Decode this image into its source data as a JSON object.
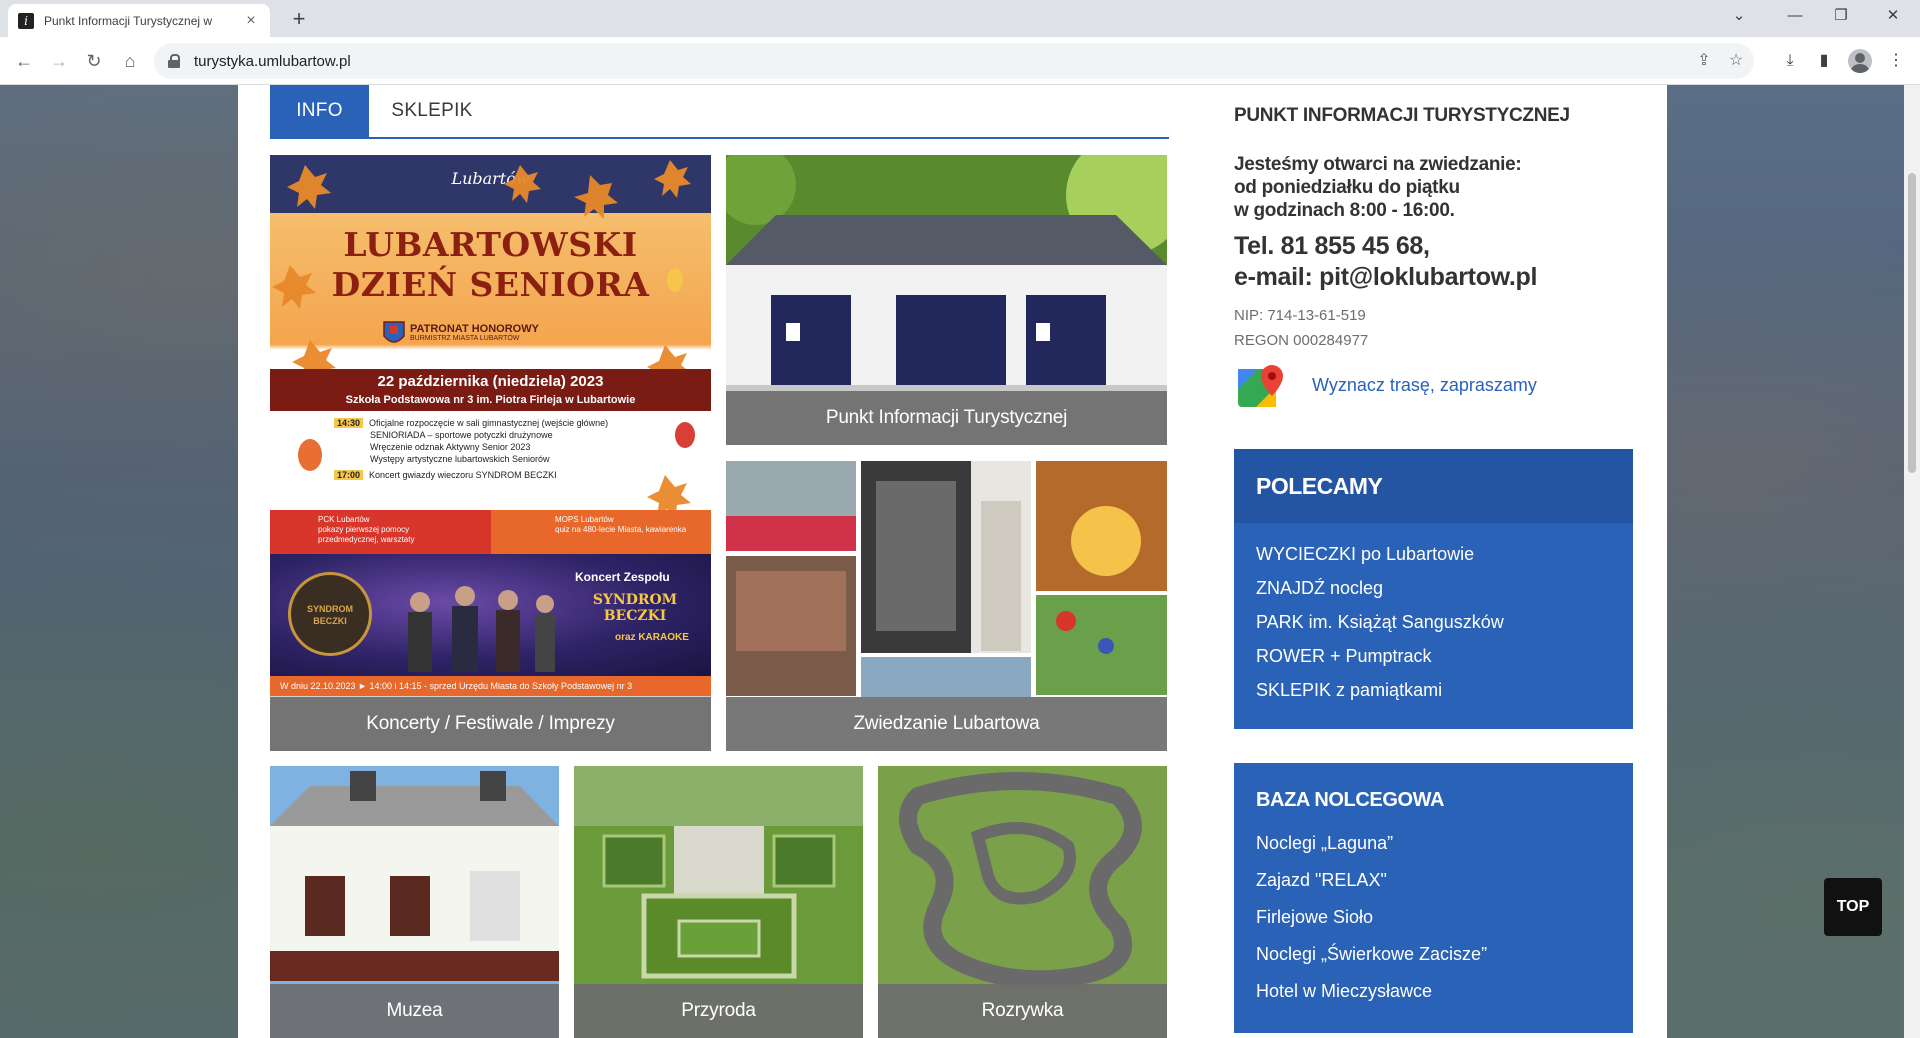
{
  "browser": {
    "tab_title": "Punkt Informacji Turystycznej w",
    "favicon_letter": "i",
    "url": "turystyka.umlubartow.pl",
    "new_tab": "+",
    "close": "×"
  },
  "page_tabs": {
    "active": "INFO",
    "inactive": "SKLEPIK"
  },
  "tiles": {
    "poster_caption": "Koncerty / Festiwale / Imprezy",
    "info_point_caption": "Punkt Informacji Turystycznej",
    "sightseeing_caption": "Zwiedzanie Lubartowa",
    "museums_caption": "Muzea",
    "nature_caption": "Przyroda",
    "fun_caption": "Rozrywka"
  },
  "poster": {
    "logo": "Lubartów",
    "title_line1": "LUBARTOWSKI",
    "title_line2": "DZIEŃ SENIORA",
    "patron": "PATRONAT HONOROWY",
    "patron_sub": "BURMISTRZ MIASTA LUBARTÓW",
    "date": "22 października (niedziela) 2023",
    "venue": "Szkoła Podstawowa nr 3 im. Piotra Firleja w Lubartowie",
    "schedule": [
      {
        "time": "14:30",
        "text": "Oficjalne rozpoczęcie w sali gimnastycznej (wejście główne)"
      },
      {
        "time": "",
        "text": "SENIORIADA – sportowe potyczki drużynowe"
      },
      {
        "time": "",
        "text": "Wręczenie odznak Aktywny Senior 2023"
      },
      {
        "time": "",
        "text": "Występy artystyczne lubartowskich Seniorów"
      },
      {
        "time": "17:00",
        "text": "Koncert gwiazdy wieczoru SYNDROM BECZKI"
      }
    ],
    "pck": "PCK Lubartów",
    "pck_text": "pokazy pierwszej pomocy przedmedycznej, warsztaty",
    "mops": "MOPS Lubartów",
    "mops_text": "quiz na 480-lecie Miasta, kawiarenka",
    "concert_title": "Koncert Zespołu",
    "band": "SYNDROM BECZKI",
    "karaoke": "oraz KARAOKE",
    "band_logo": "SYNDROM BECZKI",
    "footer": "W dniu 22.10.2023   ► 14:00 i 14:15 - sprzed Urzędu Miasta do Szkoły Podstawowej nr 3"
  },
  "sidebar": {
    "title": "PUNKT INFORMACJI TURYSTYCZNEJ",
    "hours_line1": "Jesteśmy otwarci na zwiedzanie:",
    "hours_line2": "od poniedziałku do piątku",
    "hours_line3": "w godzinach 8:00 - 16:00.",
    "phone": "Tel. 81 855 45 68,",
    "email": "e-mail: pit@loklubartow.pl",
    "nip": "NIP: 714-13-61-519",
    "regon": "REGON 000284977",
    "maps_link": "Wyznacz trasę, zapraszamy",
    "recommend_title": "POLECAMY",
    "recommend_items": [
      "WYCIECZKI po Lubartowie",
      "ZNAJDŹ nocleg",
      "PARK im. Książąt Sanguszków",
      "ROWER + Pumptrack",
      "SKLEPIK z pamiątkami"
    ],
    "lodging_title": "BAZA NOLCEGOWA",
    "lodging_items": [
      "Noclegi „Laguna”",
      "Zajazd \"RELAX\"",
      "Firlejowe Sioło",
      "Noclegi „Świerkowe Zacisze”",
      "Hotel w Mieczysławce"
    ]
  },
  "top_button": "TOP",
  "colors": {
    "accent": "#2a62b8",
    "accent_dark": "#2355a3",
    "caption_bg": "#6c6c6c"
  }
}
